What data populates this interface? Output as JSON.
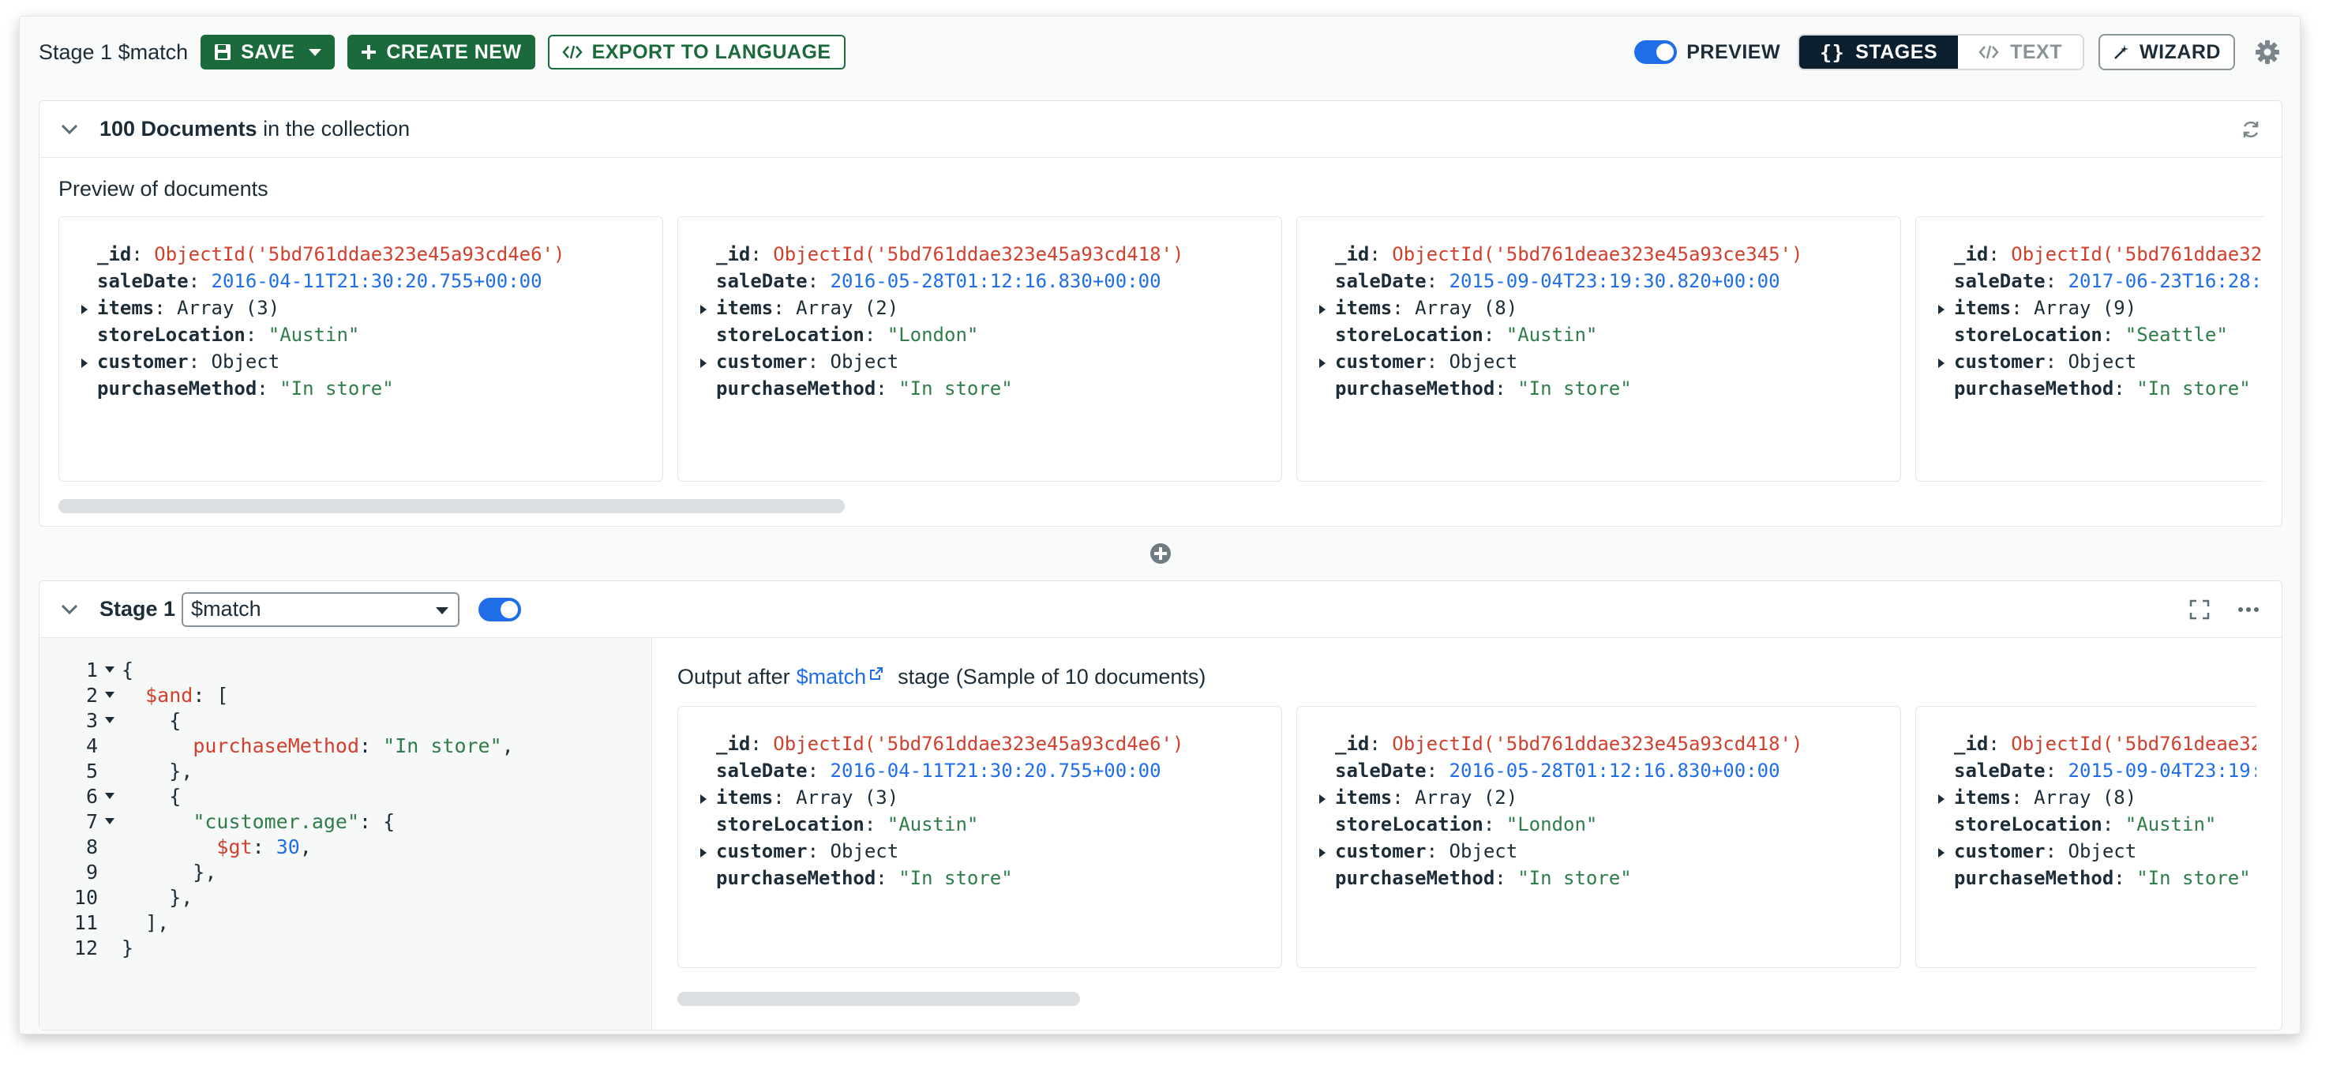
{
  "toolbar": {
    "stage_title": "Stage 1 $match",
    "save_label": "SAVE",
    "create_new_label": "CREATE NEW",
    "export_label": "EXPORT TO LANGUAGE",
    "preview_label": "PREVIEW",
    "stages_label": "STAGES",
    "text_label": "TEXT",
    "wizard_label": "WIZARD"
  },
  "collection": {
    "count_bold": "100 Documents",
    "count_suffix": " in the collection",
    "preview_label": "Preview of documents"
  },
  "documents": [
    {
      "id": "ObjectId('5bd761ddae323e45a93cd4e6')",
      "saleDate": "2016-04-11T21:30:20.755+00:00",
      "items": "Array (3)",
      "storeLocation": "\"Austin\"",
      "customer": "Object",
      "purchaseMethod": "\"In store\""
    },
    {
      "id": "ObjectId('5bd761ddae323e45a93cd418')",
      "saleDate": "2016-05-28T01:12:16.830+00:00",
      "items": "Array (2)",
      "storeLocation": "\"London\"",
      "customer": "Object",
      "purchaseMethod": "\"In store\""
    },
    {
      "id": "ObjectId('5bd761deae323e45a93ce345')",
      "saleDate": "2015-09-04T23:19:30.820+00:00",
      "items": "Array (8)",
      "storeLocation": "\"Austin\"",
      "customer": "Object",
      "purchaseMethod": "\"In store\""
    },
    {
      "id": "ObjectId('5bd761ddae32",
      "saleDate": "2017-06-23T16:28:",
      "items": "Array (9)",
      "storeLocation": "\"Seattle\"",
      "customer": "Object",
      "purchaseMethod": "\"In store\""
    }
  ],
  "field_labels": {
    "id": "_id",
    "saleDate": "saleDate",
    "items": "items",
    "storeLocation": "storeLocation",
    "customer": "customer",
    "purchaseMethod": "purchaseMethod"
  },
  "stage": {
    "title": "Stage 1",
    "operator": "$match",
    "code": [
      {
        "n": "1",
        "fold": true,
        "tokens": [
          {
            "t": "{",
            "c": "c-dark"
          }
        ]
      },
      {
        "n": "2",
        "fold": true,
        "tokens": [
          {
            "t": "  ",
            "c": "c-dark"
          },
          {
            "t": "$and",
            "c": "c-red"
          },
          {
            "t": ": [",
            "c": "c-dark"
          }
        ]
      },
      {
        "n": "3",
        "fold": true,
        "tokens": [
          {
            "t": "    {",
            "c": "c-dark"
          }
        ]
      },
      {
        "n": "4",
        "fold": false,
        "tokens": [
          {
            "t": "      ",
            "c": "c-dark"
          },
          {
            "t": "purchaseMethod",
            "c": "c-red"
          },
          {
            "t": ": ",
            "c": "c-dark"
          },
          {
            "t": "\"In store\"",
            "c": "c-green"
          },
          {
            "t": ",",
            "c": "c-dark"
          }
        ]
      },
      {
        "n": "5",
        "fold": false,
        "tokens": [
          {
            "t": "    },",
            "c": "c-dark"
          }
        ]
      },
      {
        "n": "6",
        "fold": true,
        "tokens": [
          {
            "t": "    {",
            "c": "c-dark"
          }
        ]
      },
      {
        "n": "7",
        "fold": true,
        "tokens": [
          {
            "t": "      ",
            "c": "c-dark"
          },
          {
            "t": "\"customer.age\"",
            "c": "c-green"
          },
          {
            "t": ": {",
            "c": "c-dark"
          }
        ]
      },
      {
        "n": "8",
        "fold": false,
        "tokens": [
          {
            "t": "        ",
            "c": "c-dark"
          },
          {
            "t": "$gt",
            "c": "c-red"
          },
          {
            "t": ": ",
            "c": "c-dark"
          },
          {
            "t": "30",
            "c": "c-blue"
          },
          {
            "t": ",",
            "c": "c-dark"
          }
        ]
      },
      {
        "n": "9",
        "fold": false,
        "tokens": [
          {
            "t": "      },",
            "c": "c-dark"
          }
        ]
      },
      {
        "n": "10",
        "fold": false,
        "tokens": [
          {
            "t": "    },",
            "c": "c-dark"
          }
        ]
      },
      {
        "n": "11",
        "fold": false,
        "tokens": [
          {
            "t": "  ],",
            "c": "c-dark"
          }
        ]
      },
      {
        "n": "12",
        "fold": false,
        "tokens": [
          {
            "t": "}",
            "c": "c-dark"
          }
        ]
      }
    ],
    "output_prefix": "Output after",
    "output_link": "$match",
    "output_suffix": "stage (Sample of 10 documents)"
  },
  "output_documents": [
    {
      "id": "ObjectId('5bd761ddae323e45a93cd4e6')",
      "saleDate": "2016-04-11T21:30:20.755+00:00",
      "items": "Array (3)",
      "storeLocation": "\"Austin\"",
      "customer": "Object",
      "purchaseMethod": "\"In store\""
    },
    {
      "id": "ObjectId('5bd761ddae323e45a93cd418')",
      "saleDate": "2016-05-28T01:12:16.830+00:00",
      "items": "Array (2)",
      "storeLocation": "\"London\"",
      "customer": "Object",
      "purchaseMethod": "\"In store\""
    },
    {
      "id": "ObjectId('5bd761deae32",
      "saleDate": "2015-09-04T23:19:",
      "items": "Array (8)",
      "storeLocation": "\"Austin\"",
      "customer": "Object",
      "purchaseMethod": "\"In store\""
    }
  ],
  "colors": {
    "brand_green": "#1a6a3b",
    "toggle_blue": "#1f6ee8",
    "key_red": "#d23f2d",
    "string_green": "#2f7d4a",
    "date_blue": "#1f6ee8",
    "dark_navy": "#0b1f2e"
  },
  "icons": {
    "save": "floppy-disk-icon",
    "create": "plus-icon",
    "export": "code-icon",
    "stages": "curly-braces-icon",
    "text": "code-icon",
    "wizard": "magic-wand-icon",
    "settings": "gear-icon",
    "collapse": "chevron-down-icon",
    "refresh": "refresh-icon",
    "add_stage": "plus-circle-icon",
    "expand": "fullscreen-icon",
    "more": "ellipsis-icon",
    "external": "external-link-icon"
  }
}
